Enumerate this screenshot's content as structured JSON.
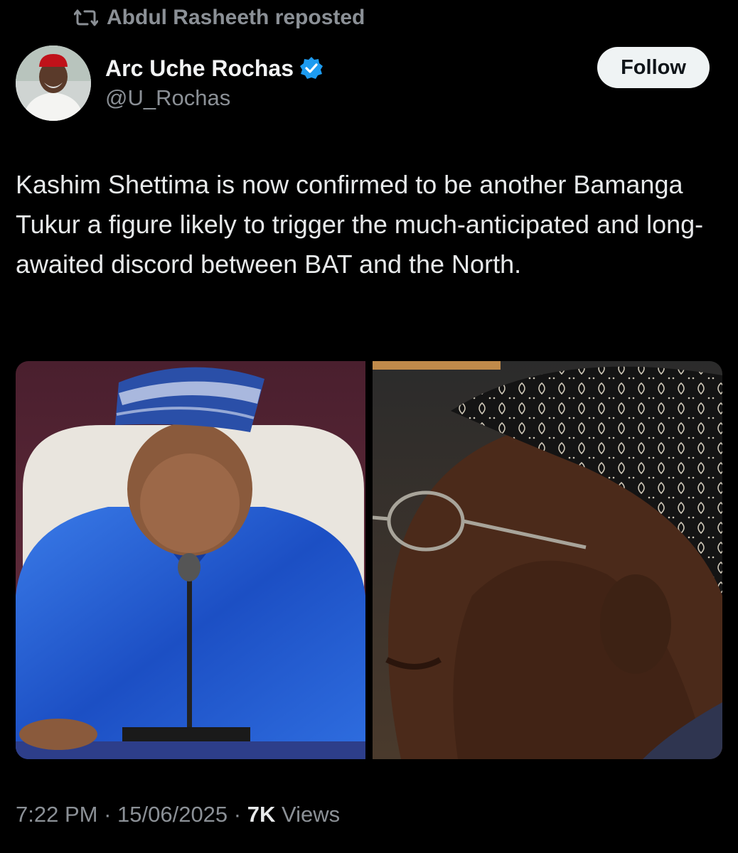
{
  "repost": {
    "icon": "repost-icon",
    "text": "Abdul Rasheeth reposted"
  },
  "author": {
    "name": "Arc Uche Rochas",
    "handle": "@U_Rochas",
    "verified_icon": "verified-badge-icon",
    "verified_color": "#1d9bf0"
  },
  "follow_button": {
    "label": "Follow"
  },
  "tweet": {
    "text": "Kashim Shettima is now confirmed to be another Bamanga Tukur a figure likely to trigger the much-anticipated and long-awaited discord between BAT and the North."
  },
  "media": {
    "left_image": "photo of man in blue agbada and cap seated at microphone",
    "right_image": "close-up profile photo of elderly man with glasses and embroidered cap"
  },
  "meta": {
    "time": "7:22 PM",
    "separator": " · ",
    "date": "15/06/2025",
    "views_count": "7K",
    "views_label": "Views"
  },
  "colors": {
    "background": "#000000",
    "text_primary": "#e7e9ea",
    "text_secondary": "#8b9096",
    "follow_bg": "#eff3f4",
    "accent": "#1d9bf0"
  }
}
